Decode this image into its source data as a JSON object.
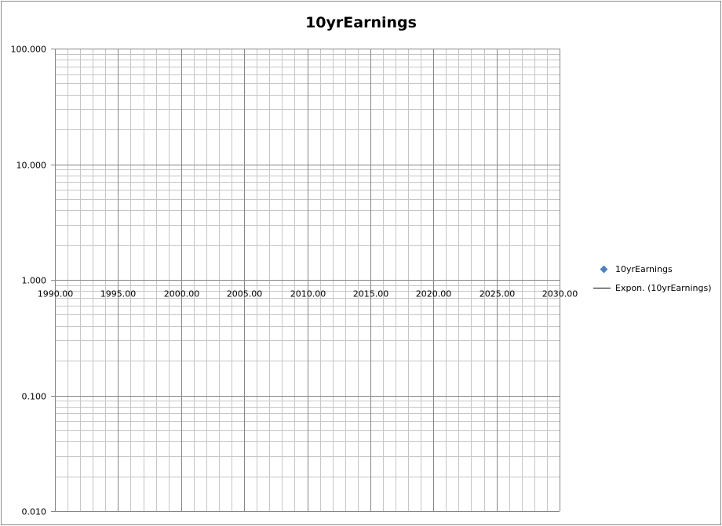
{
  "chart_data": {
    "type": "scatter",
    "title": "10yrEarnings",
    "xlabel": "",
    "ylabel": "",
    "x_scale": "linear",
    "y_scale": "log",
    "xlim": [
      1990,
      2030
    ],
    "ylim": [
      0.01,
      100
    ],
    "x_ticks": [
      1990,
      1995,
      2000,
      2005,
      2010,
      2015,
      2020,
      2025,
      2030
    ],
    "x_tick_labels": [
      "1990.00",
      "1995.00",
      "2000.00",
      "2005.00",
      "2010.00",
      "2015.00",
      "2020.00",
      "2025.00",
      "2030.00"
    ],
    "y_ticks": [
      100,
      10,
      1,
      0.1,
      0.01
    ],
    "y_tick_labels": [
      "100.000",
      "10.000",
      "1.000",
      "0.100",
      "0.010"
    ],
    "x_axis_crosses_at": 1,
    "grid": true,
    "legend_position": "right",
    "series": [
      {
        "name": "10yrEarnings",
        "kind": "scatter",
        "marker": "diamond",
        "color": "#4f81bd",
        "x": [],
        "y": []
      },
      {
        "name": "Expon. (10yrEarnings)",
        "kind": "trendline",
        "color": "#000000",
        "x": [],
        "y": []
      }
    ]
  },
  "legend": {
    "items": [
      {
        "label": "10yrEarnings"
      },
      {
        "label": "Expon. (10yrEarnings)"
      }
    ]
  }
}
